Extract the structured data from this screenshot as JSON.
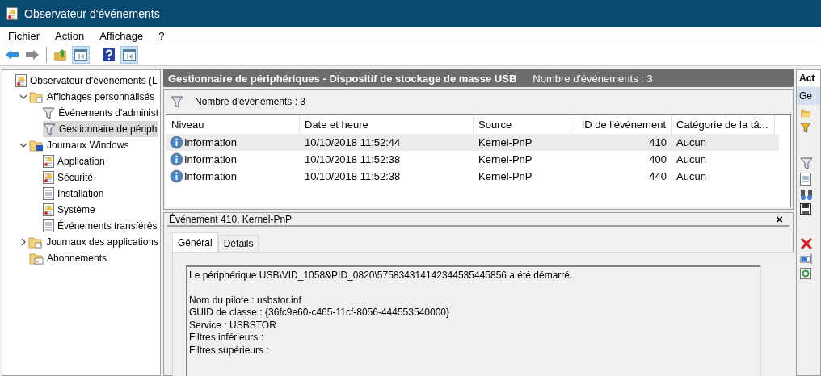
{
  "window": {
    "title": "Observateur d'événements"
  },
  "menu": [
    "Fichier",
    "Action",
    "Affichage",
    "?"
  ],
  "toolbar": [
    {
      "kind": "back",
      "pressed": false
    },
    {
      "kind": "forward",
      "pressed": false
    },
    {
      "kind": "separator"
    },
    {
      "kind": "up",
      "pressed": false
    },
    {
      "kind": "pane",
      "pressed": true
    },
    {
      "kind": "separator"
    },
    {
      "kind": "help",
      "pressed": false
    },
    {
      "kind": "pane",
      "pressed": true
    }
  ],
  "tree": [
    {
      "label": "Observateur d'événements (L",
      "kind": "viewer",
      "selected": false,
      "children": [
        {
          "label": "Affichages personnalisés",
          "kind": "folder",
          "selected": false,
          "expanded": true,
          "children": [
            {
              "label": "Événements d'administ",
              "kind": "filter",
              "selected": false
            },
            {
              "label": "Gestionnaire de périph",
              "kind": "filter",
              "selected": true
            }
          ]
        },
        {
          "label": "Journaux Windows",
          "kind": "winfolder",
          "selected": false,
          "expanded": true,
          "children": [
            {
              "label": "Application",
              "kind": "logwarn",
              "selected": false
            },
            {
              "label": "Sécurité",
              "kind": "logwarn",
              "selected": false
            },
            {
              "label": "Installation",
              "kind": "log",
              "selected": false
            },
            {
              "label": "Système",
              "kind": "logwarn",
              "selected": false
            },
            {
              "label": "Événements transférés",
              "kind": "log",
              "selected": false
            }
          ]
        },
        {
          "label": "Journaux des applications",
          "kind": "folder",
          "selected": false,
          "expanded": false
        },
        {
          "label": "Abonnements",
          "kind": "subs",
          "selected": false
        }
      ]
    }
  ],
  "header": {
    "title": "Gestionnaire de périphériques - Dispositif de stockage de masse USB",
    "count": "Nombre d'événements : 3"
  },
  "filter_bar": {
    "text": "Nombre d'événements : 3"
  },
  "table": {
    "columns": [
      {
        "label": "Niveau",
        "kind": "text"
      },
      {
        "label": "Date et heure",
        "kind": "text"
      },
      {
        "label": "Source",
        "kind": "text"
      },
      {
        "label": "ID de l'événement",
        "kind": "number"
      },
      {
        "label": "Catégorie de la tâ...",
        "kind": "text"
      }
    ],
    "rows": [
      {
        "selected": true,
        "cells": [
          "Information",
          "10/10/2018 11:52:44",
          "Kernel-PnP",
          "410",
          "Aucun"
        ]
      },
      {
        "selected": false,
        "cells": [
          "Information",
          "10/10/2018 11:52:38",
          "Kernel-PnP",
          "400",
          "Aucun"
        ]
      },
      {
        "selected": false,
        "cells": [
          "Information",
          "10/10/2018 11:52:38",
          "Kernel-PnP",
          "440",
          "Aucun"
        ]
      }
    ]
  },
  "detail": {
    "title": "Événement 410, Kernel-PnP",
    "close": "×",
    "tabs": [
      {
        "label": "Général",
        "selected": true
      },
      {
        "label": "Détails",
        "selected": false
      }
    ],
    "message": "Le périphérique USB\\VID_1058&PID_0820\\575834314142344535445856 a été démarré.",
    "properties": [
      "Nom du pilote : usbstor.inf",
      "GUID de classe : {36fc9e60-c465-11cf-8056-444553540000}",
      "Service : USBSTOR",
      "Filtres inférieurs :",
      "Filtres supérieurs :"
    ]
  },
  "actions": {
    "title": "Act",
    "section": "Ge",
    "icons": [
      {
        "kind": "open"
      },
      {
        "kind": "filter-color"
      },
      {
        "kind": "gap"
      },
      {
        "kind": "filter"
      },
      {
        "kind": "properties"
      },
      {
        "kind": "find"
      },
      {
        "kind": "save"
      },
      {
        "kind": "gap"
      },
      {
        "kind": "delete"
      },
      {
        "kind": "attach"
      },
      {
        "kind": "refresh"
      }
    ]
  }
}
